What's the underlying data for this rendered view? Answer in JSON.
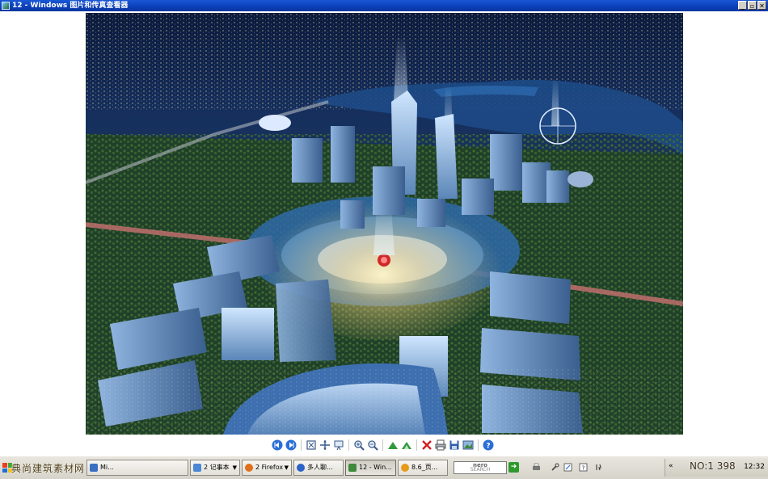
{
  "window": {
    "title": "12 - Windows 图片和传真查看器",
    "buttons": {
      "minimize": "_",
      "restore": "▫",
      "close": "✕"
    }
  },
  "image": {
    "subject": "night aerial city master plan rendering"
  },
  "toolbar": {
    "tools": [
      "previous-image-icon",
      "next-image-icon",
      "best-fit-icon",
      "actual-size-icon",
      "slideshow-icon",
      "zoom-in-icon",
      "zoom-out-icon",
      "rotate-clockwise-icon",
      "rotate-counterclockwise-icon",
      "delete-icon",
      "print-icon",
      "save-icon",
      "edit-icon",
      "help-icon"
    ]
  },
  "taskbar": {
    "watermark": "典尚建筑素材网 www.zsjzsc.net",
    "tasks": [
      {
        "label": "Mi...",
        "icon": "app-icon",
        "color": "#3a6fc4",
        "active": false
      },
      {
        "label": "2 记事本",
        "icon": "notepad-icon",
        "color": "#4a88d6",
        "active": false,
        "has_menu": true
      },
      {
        "label": "2 Firefox",
        "icon": "firefox-icon",
        "color": "#e0701c",
        "active": false,
        "has_menu": true
      },
      {
        "label": "多人聊...",
        "icon": "chat-icon",
        "color": "#2b63c7",
        "active": false
      },
      {
        "label": "12 - Win...",
        "icon": "image-viewer-icon",
        "color": "#3c8a3c",
        "active": true
      },
      {
        "label": "8.6_页...",
        "icon": "browser-icon",
        "color": "#e89a1a",
        "active": false
      }
    ],
    "search": {
      "brand": "nero",
      "sub": "SEARCH"
    },
    "tray": {
      "watermark": "NO:1 398",
      "time": "12:32"
    }
  }
}
